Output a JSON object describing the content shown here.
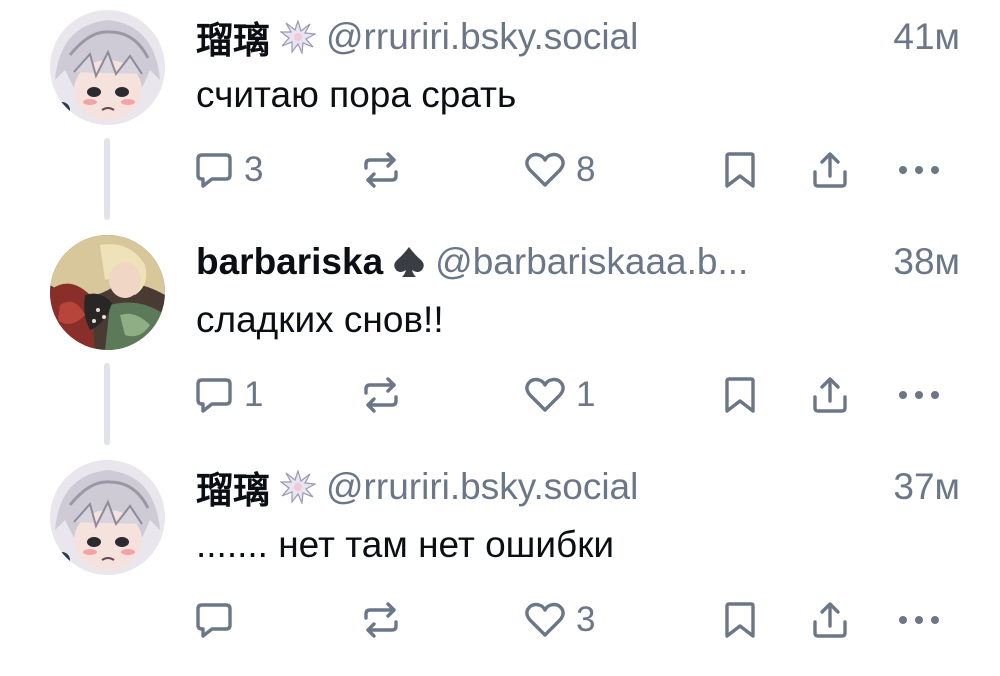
{
  "colors": {
    "text": "#0b0f14",
    "muted": "#6b7787",
    "icon": "#6b7787",
    "thread_line": "#e0e4ea"
  },
  "posts": [
    {
      "author_name": "瑠璃",
      "badge_icon": "sparkle-burst-icon",
      "handle": "@rruriri.bsky.social",
      "time": "41м",
      "text": "считаю пора срать",
      "replies": "3",
      "likes": "8",
      "avatar": "anime-boy-silver-hair-avatar"
    },
    {
      "author_name": "barbariska",
      "badge_icon": "spade-icon",
      "handle": "@barbariskaaa.b...",
      "time": "38м",
      "text": "сладких снов!!",
      "replies": "1",
      "likes": "1",
      "avatar": "illustrated-figure-avatar"
    },
    {
      "author_name": "瑠璃",
      "badge_icon": "sparkle-burst-icon",
      "handle": "@rruriri.bsky.social",
      "time": "37м",
      "text": "....... нет там нет ошибки",
      "replies": "",
      "likes": "3",
      "avatar": "anime-boy-silver-hair-avatar"
    }
  ]
}
